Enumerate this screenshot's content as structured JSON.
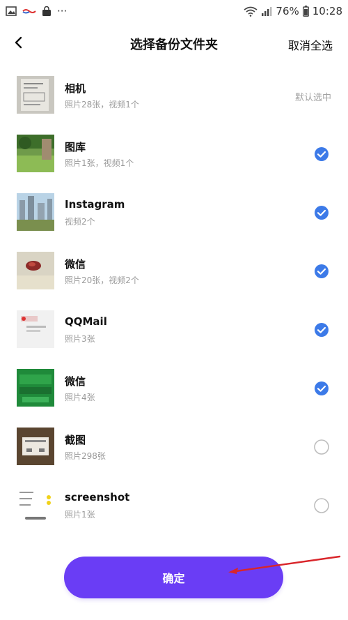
{
  "status_bar": {
    "battery_percent": "76%",
    "time": "10:28",
    "more_dots": "···"
  },
  "header": {
    "title": "选择备份文件夹",
    "cancel_all": "取消全选"
  },
  "folders": [
    {
      "name": "相机",
      "meta": "照片28张，视频1个",
      "state": "default",
      "state_label": "默认选中"
    },
    {
      "name": "图库",
      "meta": "照片1张，视频1个",
      "state": "checked"
    },
    {
      "name": "Instagram",
      "meta": "视频2个",
      "state": "checked"
    },
    {
      "name": "微信",
      "meta": "照片20张，视频2个",
      "state": "checked"
    },
    {
      "name": "QQMail",
      "meta": "照片3张",
      "state": "checked"
    },
    {
      "name": "微信",
      "meta": "照片4张",
      "state": "checked"
    },
    {
      "name": "截图",
      "meta": "照片298张",
      "state": "unchecked"
    },
    {
      "name": "screenshot",
      "meta": "照片1张",
      "state": "unchecked"
    }
  ],
  "confirm": {
    "label": "确定"
  },
  "colors": {
    "accent": "#6a3df5",
    "check": "#3c7ae8",
    "annotation": "#d9252a"
  }
}
